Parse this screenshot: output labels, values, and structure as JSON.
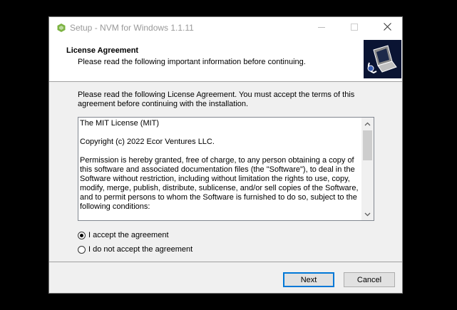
{
  "window": {
    "title": "Setup - NVM for Windows 1.1.11",
    "icons": {
      "app": "nvm-hexagon-icon",
      "minimize": "minimize-icon",
      "maximize": "maximize-icon",
      "close": "close-icon"
    }
  },
  "header": {
    "title": "License Agreement",
    "subtitle": "Please read the following important information before continuing.",
    "image": "computer-installer-graphic"
  },
  "intro": "Please read the following License Agreement. You must accept the terms of this agreement before continuing with the installation.",
  "license": {
    "paragraphs": [
      "The MIT License (MIT)",
      "Copyright (c) 2022 Ecor Ventures LLC.",
      "Permission is hereby granted, free of charge, to any person obtaining a copy of this software and associated documentation files (the \"Software\"), to deal in the Software without restriction, including without limitation the rights to use, copy, modify, merge, publish, distribute, sublicense, and/or sell copies of the Software, and to permit persons to whom the Software is furnished to do so, subject to the following conditions:"
    ]
  },
  "options": {
    "accept": "I accept the agreement",
    "decline": "I do not accept the agreement",
    "selected": "accept"
  },
  "buttons": {
    "next": "Next",
    "cancel": "Cancel"
  },
  "colors": {
    "accent": "#0078d7",
    "nvm_green": "#7cb342"
  }
}
